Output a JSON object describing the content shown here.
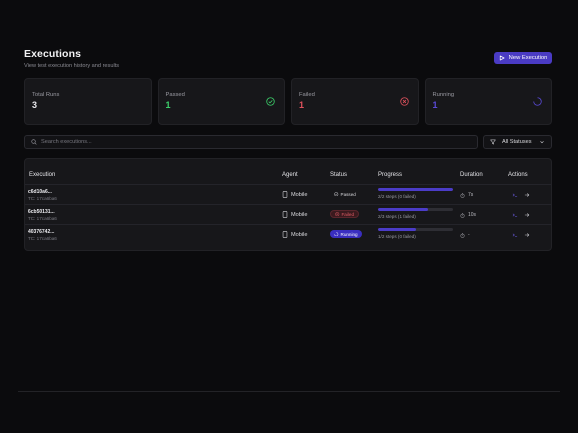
{
  "header": {
    "title": "Executions",
    "subtitle": "View test execution history and results",
    "new_button": "New Execution"
  },
  "cards": [
    {
      "label": "Total Runs",
      "value": "3",
      "color": "#e8e8ec",
      "icon": "none"
    },
    {
      "label": "Passed",
      "value": "1",
      "color": "#3ccf6a",
      "icon": "check-circle-icon"
    },
    {
      "label": "Failed",
      "value": "1",
      "color": "#e0525d",
      "icon": "x-circle-icon"
    },
    {
      "label": "Running",
      "value": "1",
      "color": "#5a4ad8",
      "icon": "spinner-icon"
    }
  ],
  "search": {
    "placeholder": "Search executions..."
  },
  "status_filter": {
    "selected": "All Statuses"
  },
  "table": {
    "headers": [
      "Execution",
      "Agent",
      "Status",
      "Progress",
      "Duration",
      "Actions"
    ],
    "rows": [
      {
        "id": "c6d10a6...",
        "tc": "TC: 17ca6ba6",
        "agent": "Mobile",
        "status": "Passed",
        "status_kind": "passed",
        "progress": 1.0,
        "steps": "2/2 steps (0 failed)",
        "duration": "7s"
      },
      {
        "id": "6cb50131...",
        "tc": "TC: 17ca6ba6",
        "agent": "Mobile",
        "status": "Failed",
        "status_kind": "failed",
        "progress": 0.67,
        "steps": "2/3 steps (1 failed)",
        "duration": "10s"
      },
      {
        "id": "40376742...",
        "tc": "TC: 17ca6ba6",
        "agent": "Mobile",
        "status": "Running",
        "status_kind": "running",
        "progress": 0.5,
        "steps": "1/2 steps (0 failed)",
        "duration": "-"
      }
    ]
  },
  "colors": {
    "accent": "#4a3bc4",
    "passed": "#3ccf6a",
    "failed": "#e0525d",
    "running": "#5a4ad8"
  }
}
